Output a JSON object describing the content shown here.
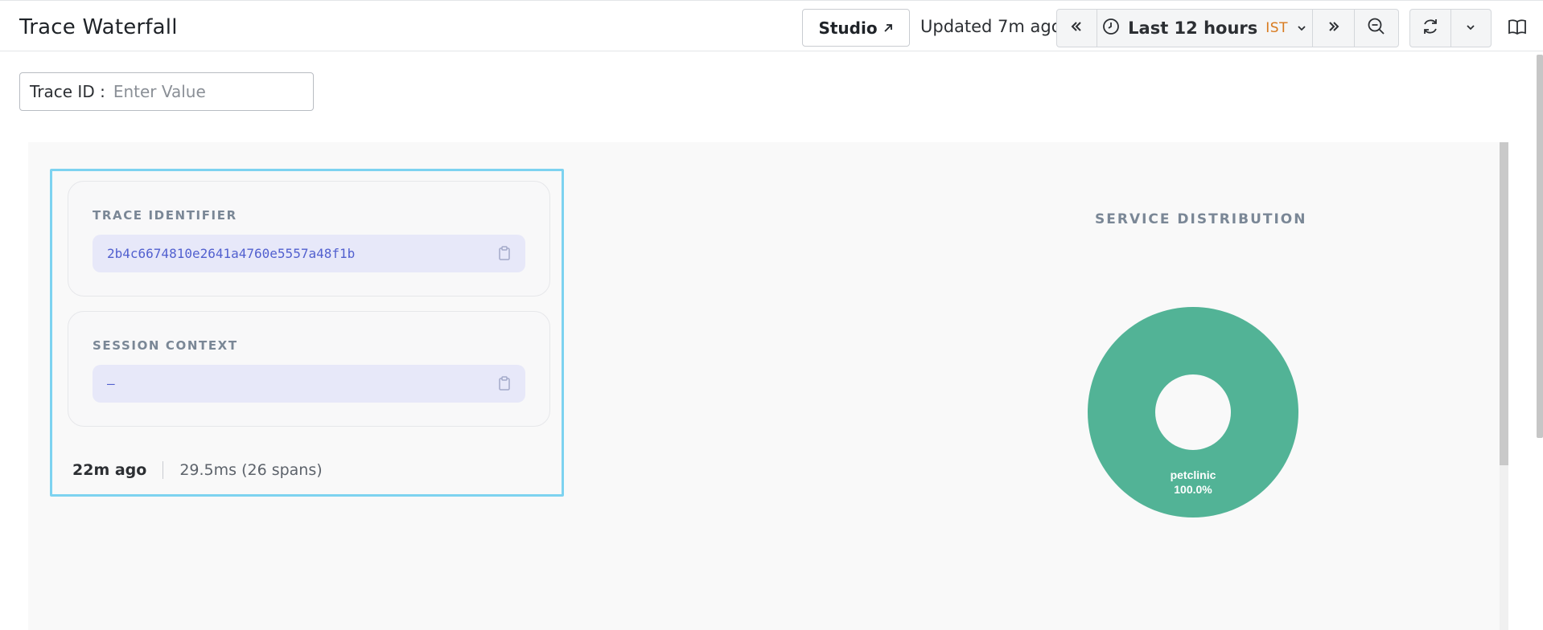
{
  "header": {
    "title": "Trace Waterfall",
    "studio_label": "Studio",
    "updated_text": "Updated 7m ago",
    "time_range": "Last 12 hours",
    "timezone": "IST"
  },
  "search": {
    "label": "Trace ID",
    "separator": ":",
    "placeholder": "Enter Value"
  },
  "trace_card": {
    "label": "TRACE IDENTIFIER",
    "value": "2b4c6674810e2641a4760e5557a48f1b"
  },
  "session_card": {
    "label": "SESSION CONTEXT",
    "value": "–"
  },
  "meta": {
    "ago": "22m ago",
    "duration": "29.5ms (26 spans)"
  },
  "distribution": {
    "title": "SERVICE DISTRIBUTION"
  },
  "chart_data": {
    "type": "pie",
    "donut": true,
    "slices": [
      {
        "label": "petclinic",
        "value": 100.0,
        "percent_label": "100.0%",
        "color": "#52b396"
      }
    ]
  },
  "colors": {
    "accent_highlight": "#7dd3f0",
    "id_text": "#5260cf",
    "timezone": "#d87a1e",
    "slice": "#52b396"
  }
}
